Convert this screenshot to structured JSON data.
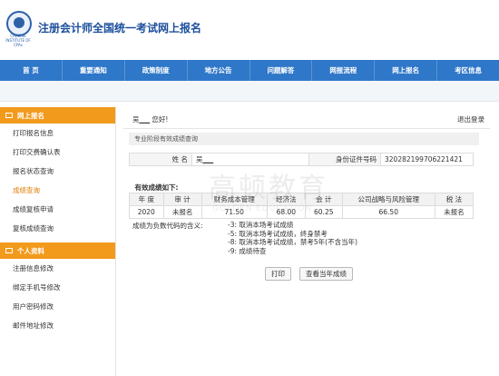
{
  "header": {
    "title": "注册会计师全国统一考试网上报名",
    "logo_text": "CHINESE INSTITUTE OF CPAs"
  },
  "nav": {
    "items": [
      "首 页",
      "重要通知",
      "政策制度",
      "地方公告",
      "问题解答",
      "网报流程",
      "网上报名",
      "考区信息"
    ]
  },
  "sidebar": {
    "section1": {
      "title": "网上报名",
      "items": [
        "打印报名信息",
        "打印交费确认表",
        "报名状态查询",
        "成绩查询",
        "成绩复核申请",
        "复核成绩查询"
      ]
    },
    "section2": {
      "title": "个人资料",
      "items": [
        "注册信息修改",
        "绑定手机号修改",
        "用户密码修改",
        "邮件地址修改"
      ]
    }
  },
  "main": {
    "greeting": "吴▁▁ 您好!",
    "logout": "退出登录",
    "section_title": "专业阶段有效成绩查询",
    "info": {
      "name_label": "姓   名",
      "name_value": "吴▁▁",
      "id_label": "身份证件号码",
      "id_value": "320282199706221421"
    },
    "score_caption": "有效成绩如下:",
    "score_headers": [
      "年 度",
      "审 计",
      "财务成本管理",
      "经济法",
      "会 计",
      "公司战略与风险管理",
      "税 法"
    ],
    "score_rows": [
      [
        "2020",
        "未报名",
        "71.50",
        "68.00",
        "60.25",
        "66.50",
        "未报名"
      ]
    ],
    "legend_label": "成绩为负数代码的含义:",
    "legend_items": [
      "-3:  取消本场考试成绩",
      "-5:  取消本场考试成绩，终身禁考",
      "-8:  取消本场考试成绩，禁考5年(不含当年)",
      "-9:  成绩待查"
    ],
    "print_button": "打印",
    "current_year_button": "查看当年成绩",
    "watermark_cn": "高顿教育",
    "watermark_en": "GOLDEN EDUCATION"
  },
  "colors": {
    "nav": "#2f77c8",
    "sidebar_header": "#f29a1c",
    "active_item": "#e07b00",
    "title": "#1c4f9c"
  }
}
